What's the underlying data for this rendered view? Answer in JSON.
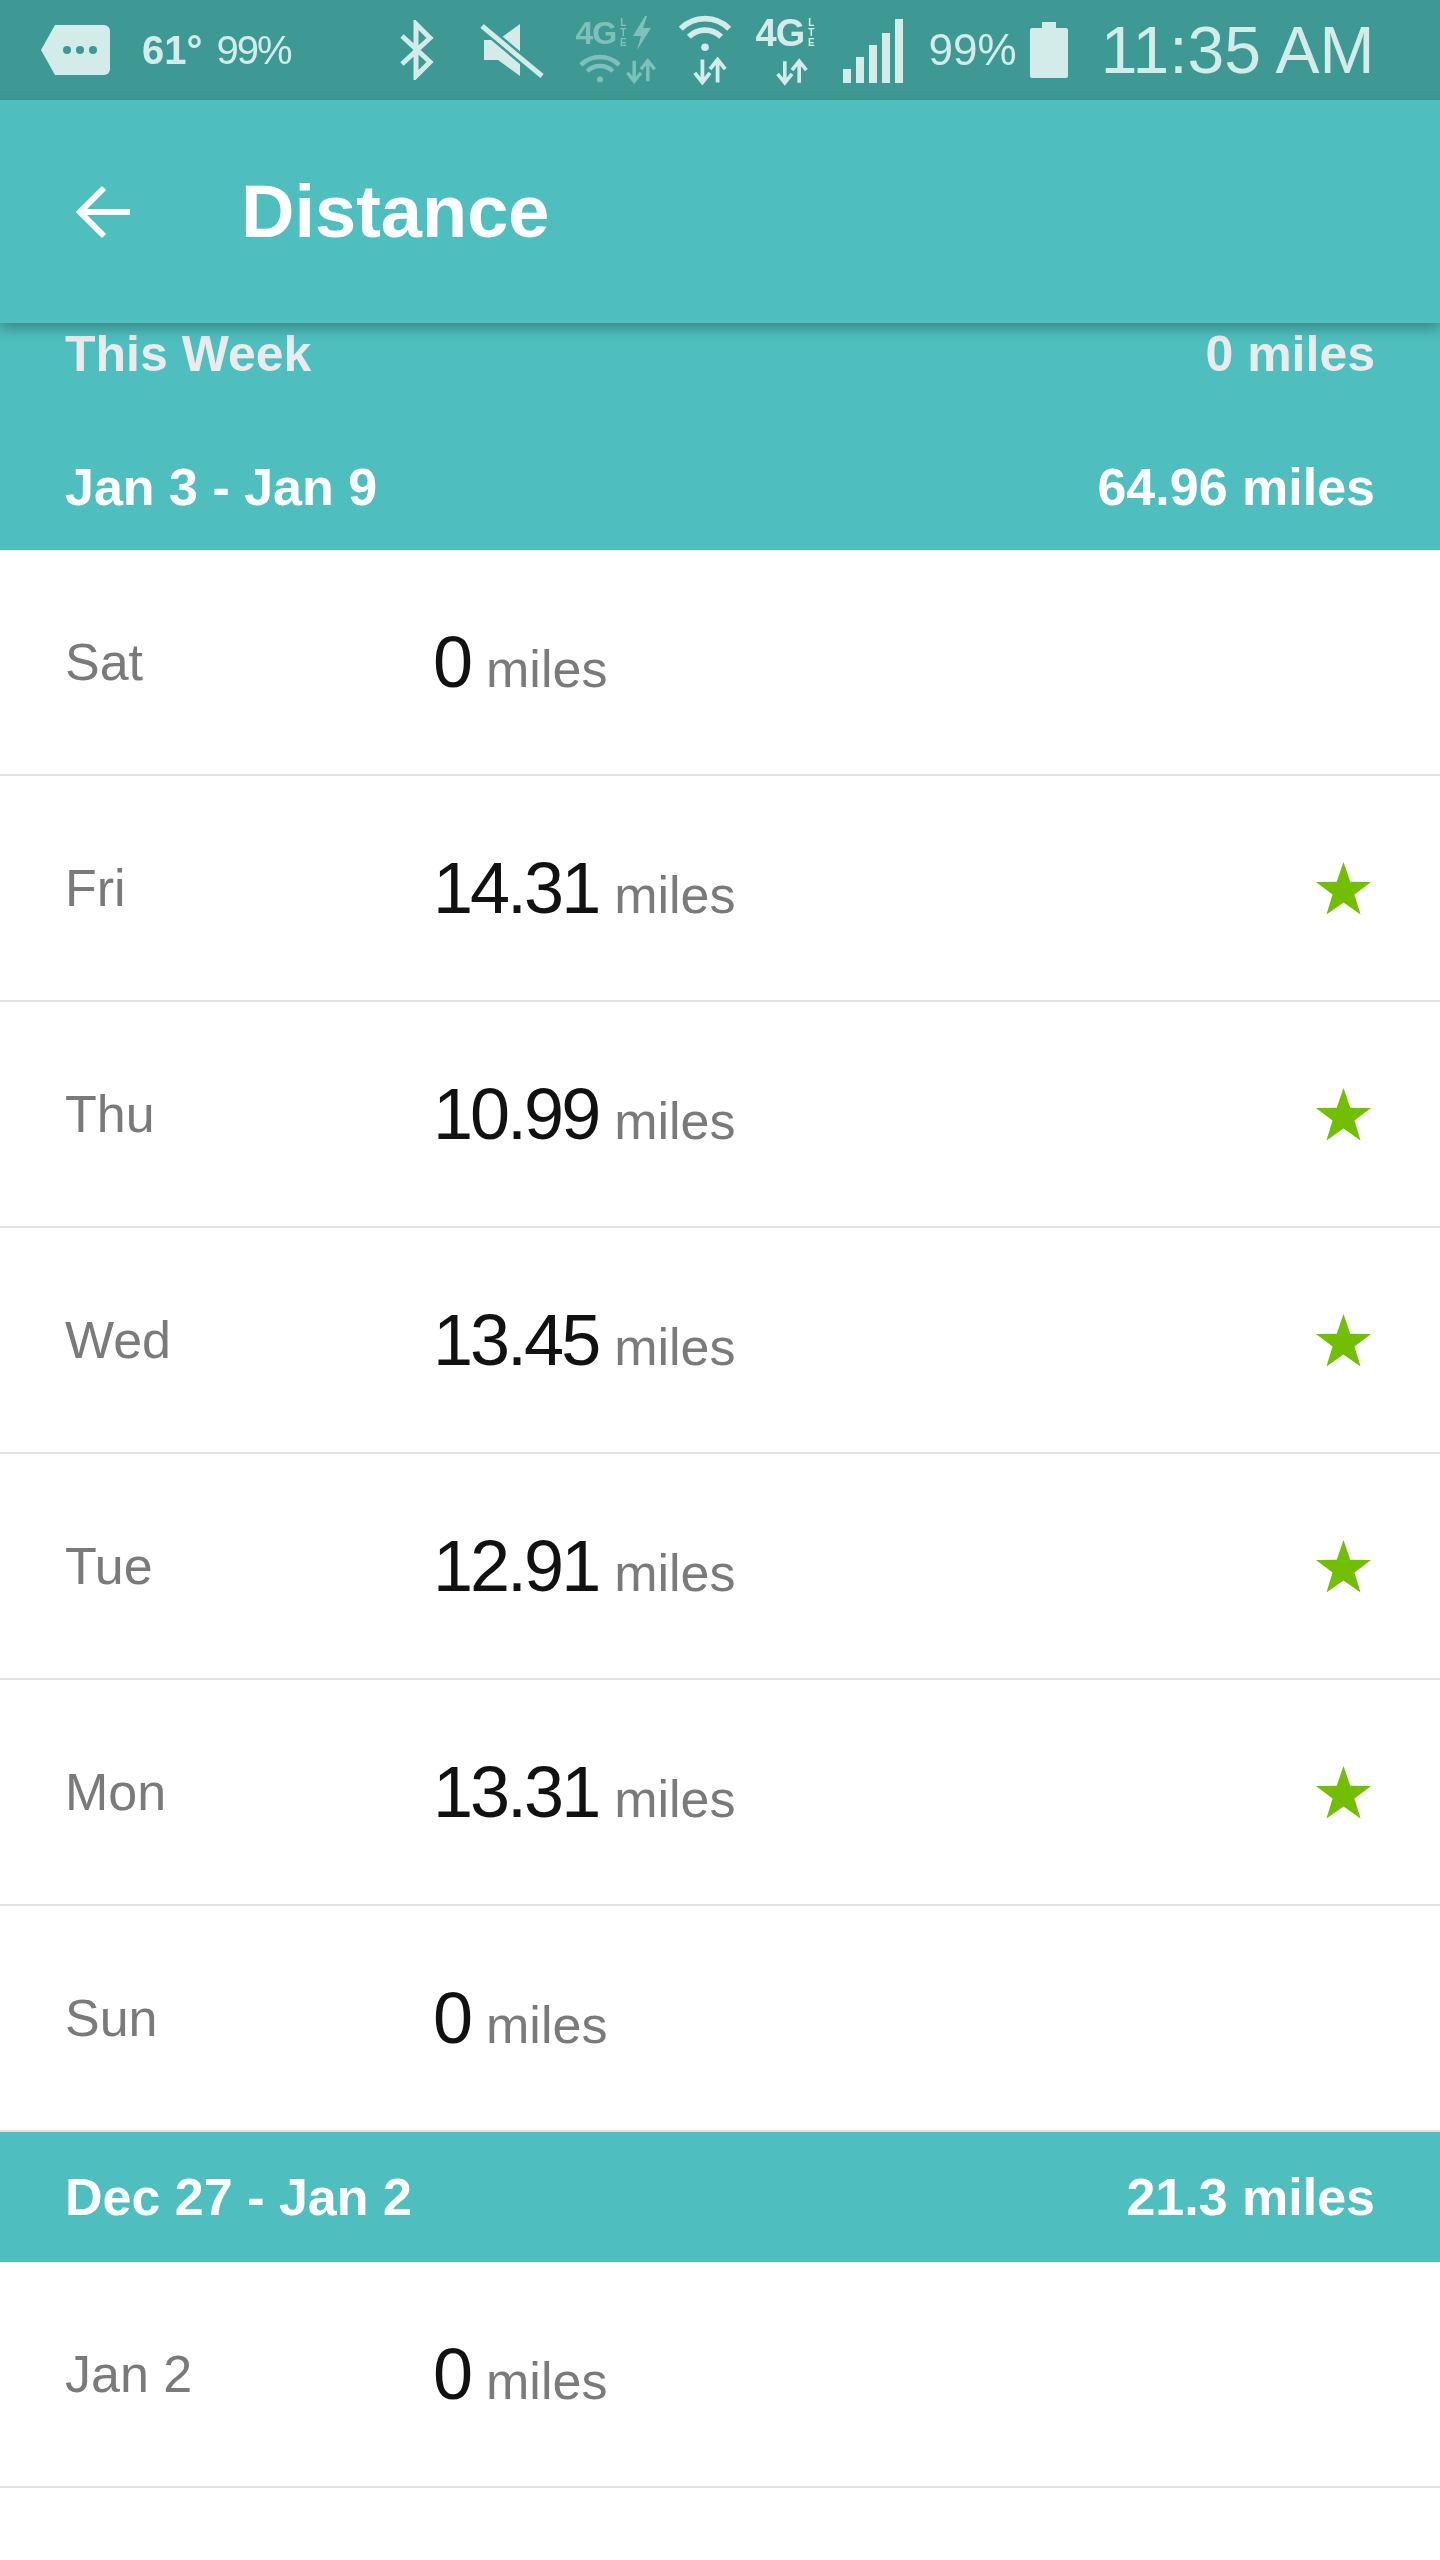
{
  "status_bar": {
    "temperature": "61°",
    "notification_percent": "99%",
    "network": [
      {
        "kind": "wifi_calling",
        "label": "4G",
        "sub": "LTE",
        "active": false
      },
      {
        "kind": "mobile_data",
        "label": "4G",
        "sub": "LTE",
        "active": true
      }
    ],
    "battery_percent": "99%",
    "time": "11:35 AM"
  },
  "app_bar": {
    "title": "Distance"
  },
  "summary": {
    "label": "This Week",
    "total": "0 miles"
  },
  "weeks": [
    {
      "range": "Jan 3 - Jan 9",
      "total": "64.96 miles",
      "days": [
        {
          "day": "Sat",
          "value": "0",
          "unit": "miles",
          "goal_met": false
        },
        {
          "day": "Fri",
          "value": "14.31",
          "unit": "miles",
          "goal_met": true
        },
        {
          "day": "Thu",
          "value": "10.99",
          "unit": "miles",
          "goal_met": true
        },
        {
          "day": "Wed",
          "value": "13.45",
          "unit": "miles",
          "goal_met": true
        },
        {
          "day": "Tue",
          "value": "12.91",
          "unit": "miles",
          "goal_met": true
        },
        {
          "day": "Mon",
          "value": "13.31",
          "unit": "miles",
          "goal_met": true
        },
        {
          "day": "Sun",
          "value": "0",
          "unit": "miles",
          "goal_met": false
        }
      ]
    },
    {
      "range": "Dec 27 - Jan 2",
      "total": "21.3 miles",
      "days": [
        {
          "day": "Jan 2",
          "value": "0",
          "unit": "miles",
          "goal_met": false
        }
      ]
    }
  ]
}
